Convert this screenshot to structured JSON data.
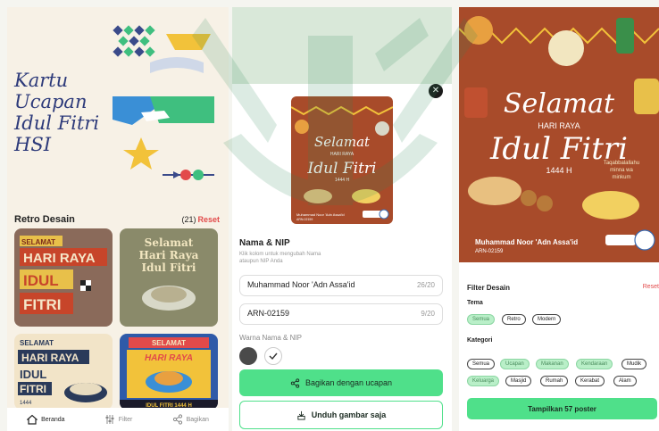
{
  "card_title": "Kartu Ucapan Idul Fitri HSI",
  "card_title_lines": [
    "Kartu",
    "Ucapan",
    "Idul Fitri",
    "HSI"
  ],
  "retro": {
    "section_title": "Retro Desain",
    "count": "(21)",
    "reset": "Reset",
    "cards": [
      {
        "lines": [
          "SELAMAT",
          "HARI RAYA",
          "IDUL",
          "FITRI"
        ]
      },
      {
        "lines": [
          "Selamat",
          "Hari Raya",
          "Idul Fitri"
        ]
      },
      {
        "lines": [
          "SELAMAT",
          "HARI RAYA",
          "IDUL",
          "FITRI",
          "1444"
        ]
      },
      {
        "lines": [
          "SELAMAT",
          "HARI RAYA",
          "IDUL FITRI 1444 H"
        ]
      }
    ]
  },
  "bottom_nav": [
    {
      "label": "Beranda",
      "icon": "home-icon"
    },
    {
      "label": "Filter",
      "icon": "sliders-icon"
    },
    {
      "label": "Bagikan",
      "icon": "share-icon"
    }
  ],
  "editor": {
    "close_icon": "close-icon",
    "section_title": "Nama & NIP",
    "help_text": "Klik kolom untuk mengubah Nama ataupun NIP Anda",
    "name_value": "Muhammad Noor 'Adn Assa'id",
    "name_count": "26/20",
    "nip_value": "ARN-02159",
    "nip_count": "9/20",
    "color_label": "Warna Nama & NIP",
    "swatches": [
      "#4a4a4a",
      "#ffffff"
    ],
    "share_button": "Bagikan dengan ucapan",
    "download_button": "Unduh gambar saja"
  },
  "poster": {
    "selamat": "Selamat",
    "hari_raya": "HARI RAYA",
    "idul_fitri": "Idul Fitri",
    "year": "1444 H",
    "wish_lines": [
      "Taqabbalallahu",
      "minna wa",
      "minkum"
    ],
    "name": "Muhammad Noor 'Adn Assa'id",
    "nip": "ARN-02159"
  },
  "filter": {
    "title": "Filter Desain",
    "reset": "Reset",
    "tema_label": "Tema",
    "tema": [
      {
        "label": "Semua",
        "selected": true
      },
      {
        "label": "Retro",
        "selected": false
      },
      {
        "label": "Modern",
        "selected": false
      }
    ],
    "kategori_label": "Kategori",
    "kategori": [
      {
        "label": "Semua",
        "selected": false
      },
      {
        "label": "Ucapan",
        "selected": true
      },
      {
        "label": "Makanan",
        "selected": true
      },
      {
        "label": "Kendaraan",
        "selected": true
      },
      {
        "label": "Mudik",
        "selected": false
      },
      {
        "label": "Keluarga",
        "selected": true
      },
      {
        "label": "Masjid",
        "selected": false
      },
      {
        "label": "Rumah",
        "selected": false
      },
      {
        "label": "Kerabat",
        "selected": false
      },
      {
        "label": "Alam",
        "selected": false
      }
    ],
    "apply_button": "Tampilkan 57 poster"
  },
  "colors": {
    "accent_green": "#4fe08a",
    "reset_red": "#e24a4a",
    "poster_bg": "#a84b2a",
    "title_blue": "#2d3a7a"
  }
}
